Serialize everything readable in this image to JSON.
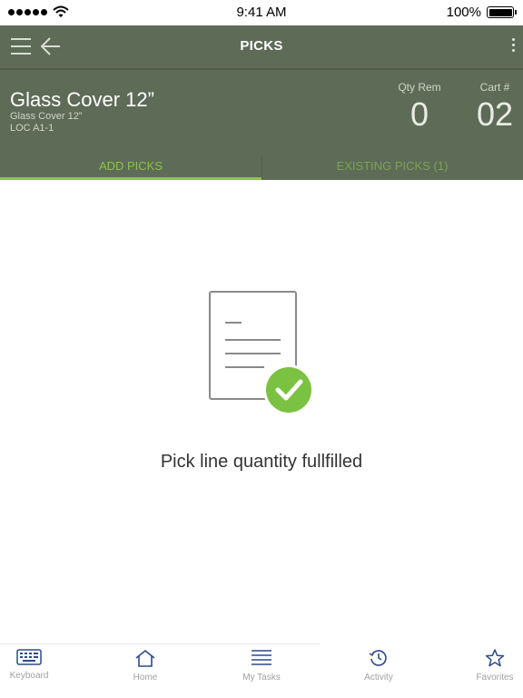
{
  "status_bar": {
    "time": "9:41 AM",
    "battery": "100%"
  },
  "header": {
    "title": "PICKS"
  },
  "item": {
    "name": "Glass Cover 12”",
    "subtitle": "Glass Cover 12”",
    "location": "LOC A1-1",
    "qty_rem_label": "Qty Rem",
    "qty_rem_value": "0",
    "cart_label": "Cart #",
    "cart_value": "02"
  },
  "tabs": [
    {
      "label": "ADD PICKS",
      "active": true
    },
    {
      "label": "EXISTING PICKS (1)",
      "active": false
    }
  ],
  "empty_state": {
    "message": "Pick line quantity fullfilled"
  },
  "bottom_nav": [
    {
      "label": "Keyboard",
      "icon": "keyboard-icon"
    },
    {
      "label": "Home",
      "icon": "home-icon"
    },
    {
      "label": "My Tasks",
      "icon": "list-icon"
    },
    {
      "label": "Activity",
      "icon": "history-icon"
    },
    {
      "label": "Favorites",
      "icon": "star-icon"
    }
  ],
  "colors": {
    "header_bg": "#5e6b57",
    "accent_green": "#8bc34a",
    "nav_icon": "#2d4a8a"
  }
}
